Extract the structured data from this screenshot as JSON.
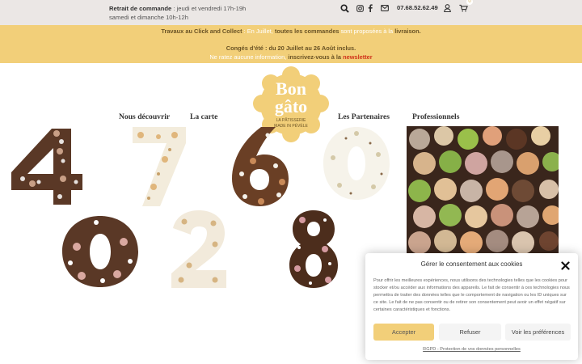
{
  "topbar": {
    "pickup_label": "Retrait de commande",
    "pickup_hours_1": ": jeudi et vendredi 17h-19h",
    "pickup_hours_2": "samedi et dimanche 10h-12h",
    "phone": "07.68.52.62.49",
    "cart_count": "0",
    "icons": [
      "search-icon",
      "instagram-icon",
      "facebook-icon",
      "email-icon",
      "user-icon",
      "cart-icon"
    ]
  },
  "announcement": {
    "l1_a": "Travaux au Click and Collect",
    "l1_b": ": En Juillet,",
    "l1_c": "toutes les commandes",
    "l1_d": "sont proposées à la",
    "l1_e": "livraison.",
    "l2_a": "Congés d'été : du 20 Juillet au  26 Août inclus.",
    "l3_a": "Ne ratez aucune information,",
    "l3_b": "inscrivez-vous à la",
    "l3_c": "newsletter"
  },
  "logo": {
    "line1": "Bon",
    "line2": "gâto",
    "sub1": "LA PÂTISSERIE",
    "sub2": "MADE IN PÉVÈLE"
  },
  "nav": {
    "decouvrir": "Nous découvrir",
    "carte": "La carte",
    "partenaires": "Les Partenaires",
    "professionnels": "Professionnels"
  },
  "cakes": [
    "4",
    "7",
    "6",
    "0",
    "0",
    "2",
    "8"
  ],
  "cookie": {
    "title": "Gérer le consentement aux cookies",
    "text": "Pour offrir les meilleures expériences, nous utilisons des technologies telles que les cookies pour stocker et/ou accéder aux informations des appareils. Le fait de consentir à ces technologies nous permettra de traiter des données telles que le comportement de navigation ou les ID uniques sur ce site. Le fait de ne pas consentir ou de retirer son consentement peut avoir un effet négatif sur certaines caractéristiques et fonctions.",
    "accept": "Accepter",
    "refuse": "Refuser",
    "prefs": "Voir les préférences",
    "link": "RGPD - Protection de vos données personnelles"
  },
  "colors": {
    "brand_yellow": "#f2cf79",
    "topbar_bg": "#ebe7e5",
    "announce_dark": "#6a5325",
    "announce_red": "#d0321a"
  }
}
